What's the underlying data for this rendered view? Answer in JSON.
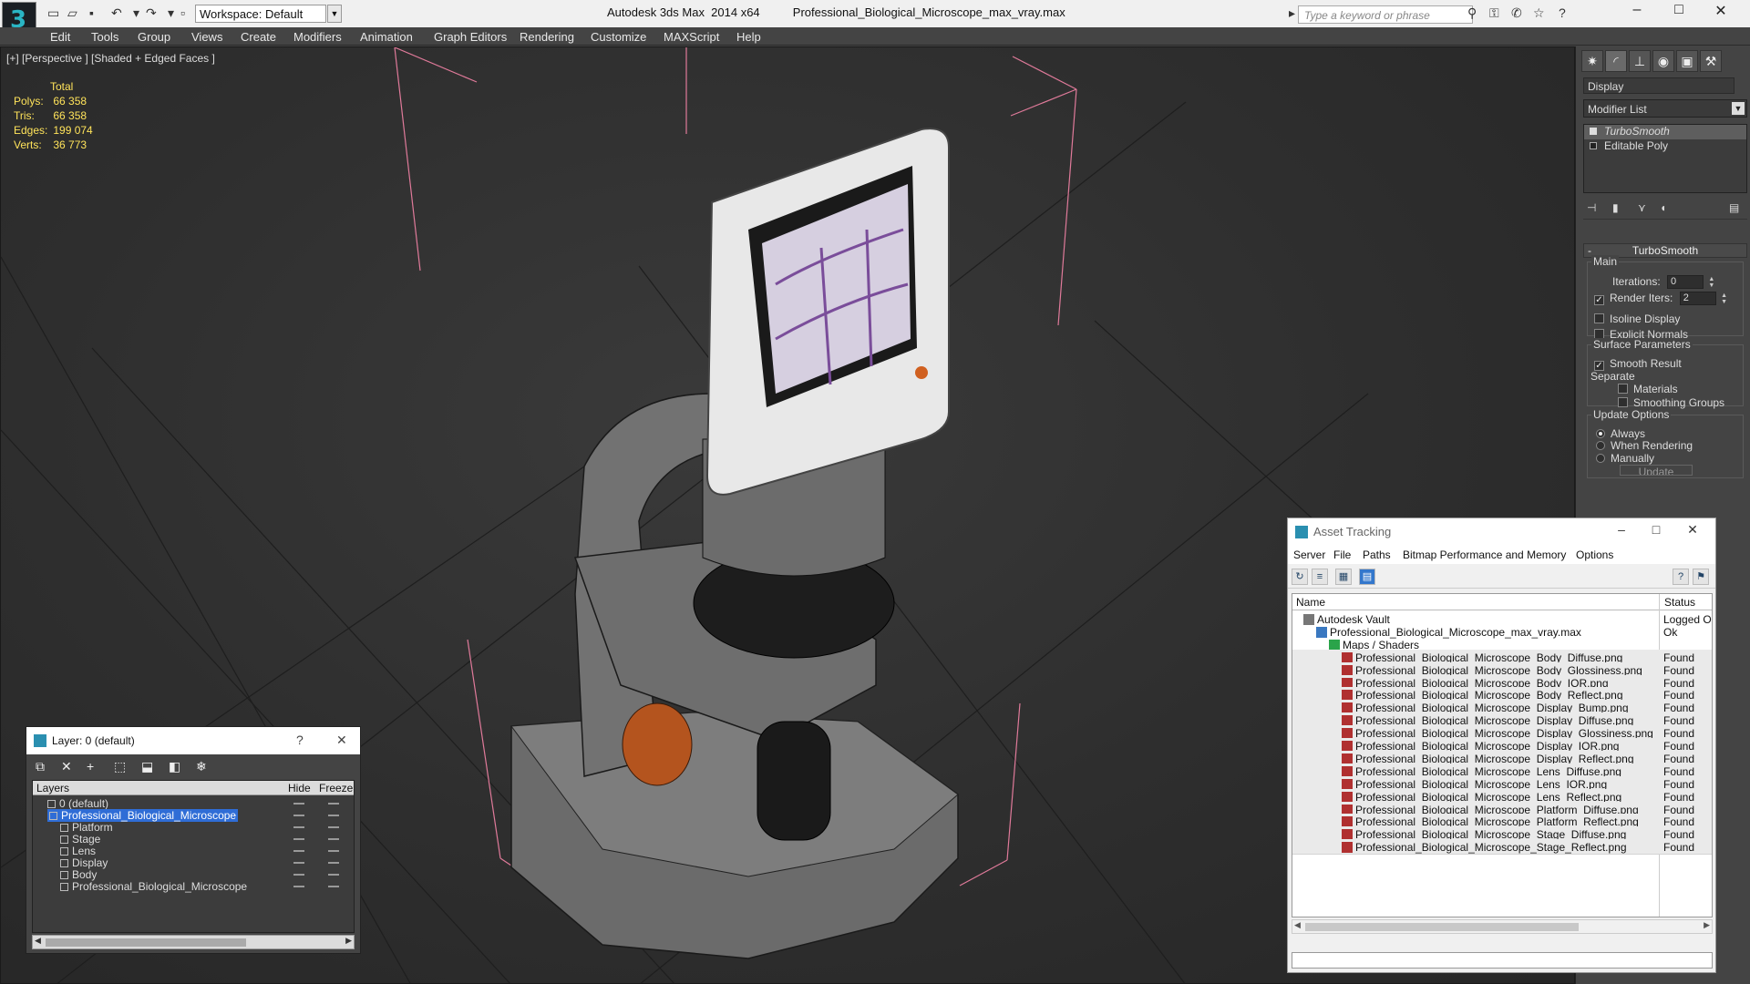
{
  "titlebar": {
    "app_title": "Autodesk 3ds Max  2014 x64",
    "file_title": "Professional_Biological_Microscope_max_vray.max",
    "workspace_label": "Workspace: Default",
    "search_placeholder": "Type a keyword or phrase"
  },
  "menu": [
    "Edit",
    "Tools",
    "Group",
    "Views",
    "Create",
    "Modifiers",
    "Animation",
    "Graph Editors",
    "Rendering",
    "Customize",
    "MAXScript",
    "Help"
  ],
  "viewport": {
    "label": "[+] [Perspective ] [Shaded + Edged Faces ]",
    "stats": {
      "header": "Total",
      "polys_label": "Polys:",
      "polys": "66 358",
      "tris_label": "Tris:",
      "tris": "66 358",
      "edges_label": "Edges:",
      "edges": "199 074",
      "verts_label": "Verts:",
      "verts": "36 773"
    }
  },
  "command_panel": {
    "object_name": "Display",
    "modifier_list": "Modifier List",
    "stack": [
      "TurboSmooth",
      "Editable Poly"
    ],
    "rollout_title": "TurboSmooth",
    "main_group": "Main",
    "iterations_label": "Iterations:",
    "iterations_value": "0",
    "render_iters_label": "Render Iters:",
    "render_iters_value": "2",
    "isoline_label": "Isoline Display",
    "explicit_normals_label": "Explicit Normals",
    "surface_group": "Surface Parameters",
    "smooth_result_label": "Smooth Result",
    "separate_label": "Separate",
    "materials_label": "Materials",
    "smoothing_groups_label": "Smoothing Groups",
    "update_group": "Update Options",
    "always_label": "Always",
    "when_rendering_label": "When Rendering",
    "manually_label": "Manually",
    "update_button": "Update"
  },
  "asset_tracking": {
    "title": "Asset Tracking",
    "menu": [
      "Server",
      "File",
      "Paths",
      "Bitmap Performance and Memory",
      "Options"
    ],
    "col_name": "Name",
    "col_status": "Status",
    "rows": [
      {
        "name": "Autodesk Vault",
        "status": "Logged Ou",
        "kind": "vault"
      },
      {
        "name": "Professional_Biological_Microscope_max_vray.max",
        "status": "Ok",
        "kind": "max"
      },
      {
        "name": "Maps / Shaders",
        "status": "",
        "kind": "maps"
      },
      {
        "name": "Professional_Biological_Microscope_Body_Diffuse.png",
        "status": "Found",
        "kind": "png"
      },
      {
        "name": "Professional_Biological_Microscope_Body_Glossiness.png",
        "status": "Found",
        "kind": "png"
      },
      {
        "name": "Professional_Biological_Microscope_Body_IOR.png",
        "status": "Found",
        "kind": "png"
      },
      {
        "name": "Professional_Biological_Microscope_Body_Reflect.png",
        "status": "Found",
        "kind": "png"
      },
      {
        "name": "Professional_Biological_Microscope_Display_Bump.png",
        "status": "Found",
        "kind": "png"
      },
      {
        "name": "Professional_Biological_Microscope_Display_Diffuse.png",
        "status": "Found",
        "kind": "png"
      },
      {
        "name": "Professional_Biological_Microscope_Display_Glossiness.png",
        "status": "Found",
        "kind": "png"
      },
      {
        "name": "Professional_Biological_Microscope_Display_IOR.png",
        "status": "Found",
        "kind": "png"
      },
      {
        "name": "Professional_Biological_Microscope_Display_Reflect.png",
        "status": "Found",
        "kind": "png"
      },
      {
        "name": "Professional_Biological_Microscope_Lens_Diffuse.png",
        "status": "Found",
        "kind": "png"
      },
      {
        "name": "Professional_Biological_Microscope_Lens_IOR.png",
        "status": "Found",
        "kind": "png"
      },
      {
        "name": "Professional_Biological_Microscope_Lens_Reflect.png",
        "status": "Found",
        "kind": "png"
      },
      {
        "name": "Professional_Biological_Microscope_Platform_Diffuse.png",
        "status": "Found",
        "kind": "png"
      },
      {
        "name": "Professional_Biological_Microscope_Platform_Reflect.png",
        "status": "Found",
        "kind": "png"
      },
      {
        "name": "Professional_Biological_Microscope_Stage_Diffuse.png",
        "status": "Found",
        "kind": "png"
      },
      {
        "name": "Professional_Biological_Microscope_Stage_Reflect.png",
        "status": "Found",
        "kind": "png"
      }
    ]
  },
  "layers_window": {
    "title": "Layer: 0 (default)",
    "col_layers": "Layers",
    "col_hide": "Hide",
    "col_freeze": "Freeze",
    "rows": [
      {
        "name": "0 (default)",
        "level": 1
      },
      {
        "name": "Professional_Biological_Microscope",
        "level": 1
      },
      {
        "name": "Platform",
        "level": 2
      },
      {
        "name": "Stage",
        "level": 2
      },
      {
        "name": "Lens",
        "level": 2
      },
      {
        "name": "Display",
        "level": 2
      },
      {
        "name": "Body",
        "level": 2
      },
      {
        "name": "Professional_Biological_Microscope",
        "level": 2
      }
    ]
  }
}
